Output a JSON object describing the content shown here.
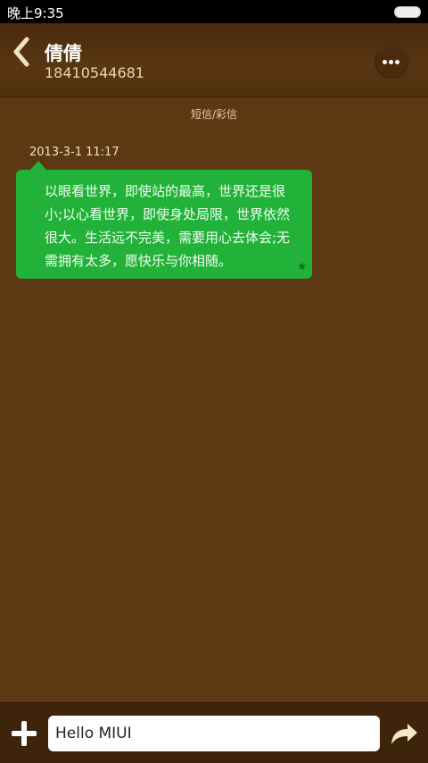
{
  "status_bar": {
    "time": "晚上9:35"
  },
  "header": {
    "contact_name": "倩倩",
    "contact_number": "18410544681"
  },
  "conversation": {
    "type_label": "短信/彩信",
    "messages": [
      {
        "timestamp": "2013-3-1 11:17",
        "text": "以眼看世界，即使站的最高，世界还是很小;以心看世界，即使身处局限，世界依然很大。生活远不完美，需要用心去体会;无需拥有太多，愿快乐与你相随。",
        "starred": true
      }
    ]
  },
  "composer": {
    "input_value": "Hello MIUI"
  },
  "colors": {
    "background": "#5c3813",
    "bubble": "#22b23a",
    "header": "#4a2a0c"
  },
  "icons": [
    "back-icon",
    "more-icon",
    "star-icon",
    "add-icon",
    "send-icon"
  ]
}
